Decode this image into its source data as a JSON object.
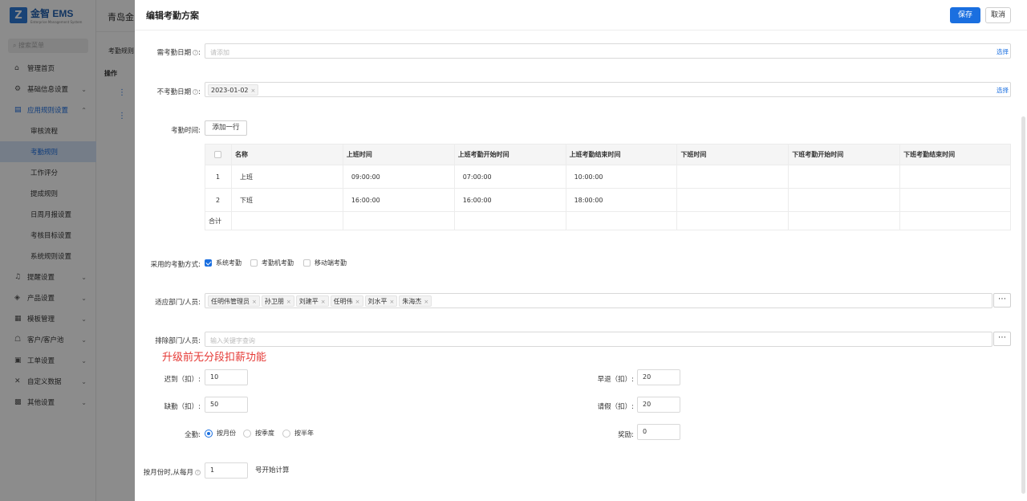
{
  "app": {
    "logo_mark": "Z",
    "logo_name": "金智 EMS",
    "logo_sub": "Enterprise Management System",
    "company": "青岛金"
  },
  "sidebar": {
    "search_placeholder": "搜索菜单",
    "items": [
      {
        "label": "管理首页",
        "icon": "home-icon",
        "glyph": "⌂"
      },
      {
        "label": "基础信息设置",
        "icon": "gear-icon",
        "glyph": "⚙"
      },
      {
        "label": "应用规则设置",
        "icon": "document-icon",
        "glyph": "▤"
      },
      {
        "label": "审核流程"
      },
      {
        "label": "考勤规则"
      },
      {
        "label": "工作评分"
      },
      {
        "label": "提成规则"
      },
      {
        "label": "日周月报设置"
      },
      {
        "label": "考核目标设置"
      },
      {
        "label": "系统规则设置"
      },
      {
        "label": "提醒设置",
        "icon": "bell-icon",
        "glyph": "♫"
      },
      {
        "label": "产品设置",
        "icon": "box-icon",
        "glyph": "◈"
      },
      {
        "label": "模板管理",
        "icon": "template-icon",
        "glyph": "▦"
      },
      {
        "label": "客户/客户池",
        "icon": "customer-icon",
        "glyph": "☖"
      },
      {
        "label": "工单设置",
        "icon": "workorder-icon",
        "glyph": "▣"
      },
      {
        "label": "自定义数据",
        "icon": "custom-data-icon",
        "glyph": "✕"
      },
      {
        "label": "其他设置",
        "icon": "apps-icon",
        "glyph": "▩"
      }
    ]
  },
  "background": {
    "tab": "考勤规则",
    "table_header": "操作",
    "row_op": "⋮"
  },
  "drawer": {
    "title": "编辑考勤方案",
    "save": "保存",
    "cancel": "取消",
    "need_date": {
      "label": "需考勤日期",
      "placeholder": "请添加",
      "select": "选择"
    },
    "no_date": {
      "label": "不考勤日期",
      "tags": [
        "2023-01-02"
      ],
      "select": "选择"
    },
    "time": {
      "label": "考勤时间:",
      "add_row": "添加一行"
    },
    "table": {
      "headers": [
        "名称",
        "上班时间",
        "上班考勤开始时间",
        "上班考勤结束时间",
        "下班时间",
        "下班考勤开始时间",
        "下班考勤结束时间"
      ],
      "rows": [
        [
          "1",
          "上班",
          "09:00:00",
          "07:00:00",
          "10:00:00",
          "",
          "",
          ""
        ],
        [
          "2",
          "下班",
          "16:00:00",
          "16:00:00",
          "18:00:00",
          "",
          "",
          ""
        ]
      ],
      "total": "合计"
    },
    "method": {
      "label": "采用的考勤方式:",
      "options": [
        "系统考勤",
        "考勤机考勤",
        "移动端考勤"
      ]
    },
    "applicable": {
      "label": "适应部门/人员:",
      "tags": [
        "任明伟管理员",
        "孙卫朋",
        "刘建平",
        "任明伟",
        "刘水平",
        "朱海杰"
      ]
    },
    "exclude": {
      "label": "排除部门/人员:",
      "placeholder": "输入关键字查询"
    },
    "warning": "升级前无分段扣薪功能",
    "late": {
      "label": "迟到（扣）:",
      "value": "10"
    },
    "early": {
      "label": "早退（扣）:",
      "value": "20"
    },
    "absent": {
      "label": "缺勤（扣）:",
      "value": "50"
    },
    "leave": {
      "label": "请假（扣）:",
      "value": "20"
    },
    "full": {
      "label": "全勤:",
      "options": [
        "按月份",
        "按季度",
        "按半年"
      ]
    },
    "reward": {
      "label": "奖励:",
      "value": "0"
    },
    "monthly": {
      "label": "按月份时,从每月",
      "value": "1",
      "suffix": "号开始计算"
    }
  },
  "colors": {
    "primary": "#1a6fe0",
    "warning": "#e53935",
    "selected_bg": "#d6e4f7"
  }
}
